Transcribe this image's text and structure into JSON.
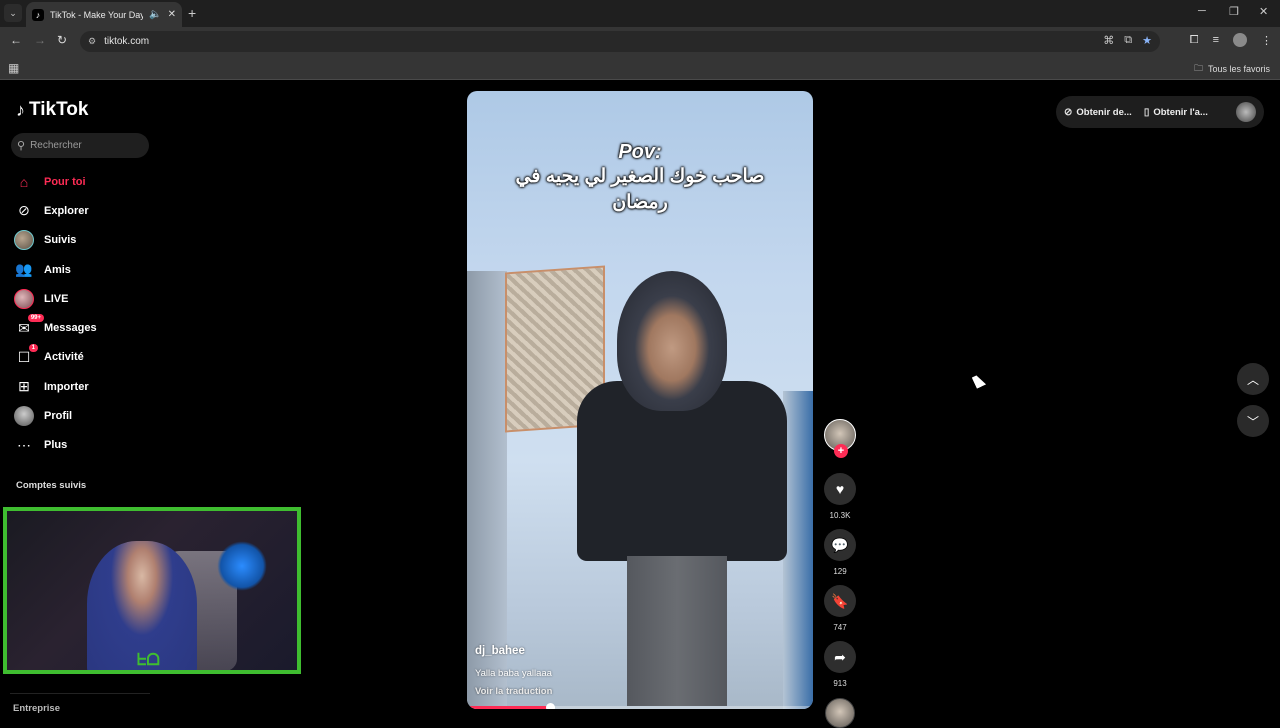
{
  "browser": {
    "tab_title": "TikTok - Make Your Day",
    "url": "tiktok.com",
    "bookmarks_all": "Tous les favoris"
  },
  "sidebar": {
    "logo_text": "TikTok",
    "search_placeholder": "Rechercher",
    "items": [
      {
        "label": "Pour toi",
        "icon": "home-icon",
        "active": true
      },
      {
        "label": "Explorer",
        "icon": "compass-icon"
      },
      {
        "label": "Suivis",
        "icon": "following-avatar-icon"
      },
      {
        "label": "Amis",
        "icon": "friends-icon"
      },
      {
        "label": "LIVE",
        "icon": "live-avatar-icon"
      },
      {
        "label": "Messages",
        "icon": "messages-icon",
        "badge": "99+"
      },
      {
        "label": "Activité",
        "icon": "activity-icon",
        "badge": "1"
      },
      {
        "label": "Importer",
        "icon": "upload-icon"
      },
      {
        "label": "Profil",
        "icon": "profile-avatar-icon"
      },
      {
        "label": "Plus",
        "icon": "more-icon"
      }
    ],
    "followed_title": "Comptes suivis",
    "footer_title": "Entreprise"
  },
  "topbar": {
    "get_coins": "Obtenir de...",
    "get_app": "Obtenir l'a..."
  },
  "video": {
    "caption_pov": "Pov:",
    "caption_arabic": "صاحب خوك الصغير لي يجيه في رمضان",
    "author": "dj_bahee",
    "description": "Yalla baba yallaaa",
    "translate": "Voir la traduction",
    "progress_fraction": 0.24
  },
  "actions": {
    "likes": "10.3K",
    "comments": "129",
    "saves": "747",
    "shares": "913"
  },
  "colors": {
    "accent": "#fe2c55",
    "webcam_border": "#3fbd30"
  }
}
